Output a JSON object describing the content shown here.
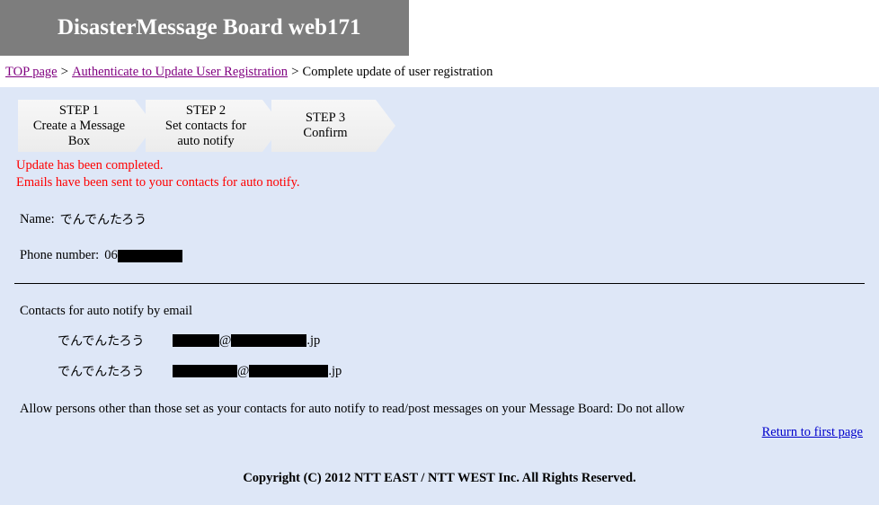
{
  "header": {
    "title": "DisasterMessage Board web171",
    "bg_color": "#7d7d7d",
    "title_color": "#ffffff"
  },
  "breadcrumb": {
    "items": [
      {
        "label": "TOP page",
        "link": true
      },
      {
        "label": "Authenticate to Update User Registration",
        "link": true
      },
      {
        "label": "Complete update of user registration",
        "link": false
      }
    ],
    "separator": ">",
    "link_color": "#800080"
  },
  "steps": [
    {
      "number": "STEP 1",
      "label": "Create a Message\nBox",
      "line1": "STEP 1",
      "line2": "Create a Message",
      "line3": "Box"
    },
    {
      "number": "STEP 2",
      "label": "Set contacts for\nauto notify",
      "line1": "STEP 2",
      "line2": "Set contacts for",
      "line3": "auto notify"
    },
    {
      "number": "STEP 3",
      "label": "Confirm",
      "line1": "STEP 3",
      "line2": "Confirm",
      "line3": ""
    }
  ],
  "alerts": {
    "color": "#ff0000",
    "line1": "Update has been completed.",
    "line2": "Emails have been sent to your contacts for auto notify."
  },
  "user": {
    "name_label": "Name:",
    "name_value": "でんでんたろう",
    "phone_label": "Phone number:",
    "phone_prefix": "06",
    "phone_redacted": true
  },
  "contacts": {
    "title": "Contacts for auto notify by email",
    "rows": [
      {
        "name": "でんでんたろう",
        "at": "@",
        "tld": ".jp",
        "redacted": true
      },
      {
        "name": "でんでんたろう",
        "at": "@",
        "tld": ".jp",
        "redacted": true
      }
    ]
  },
  "permission": {
    "text": "Allow persons other than those set as your contacts for auto notify to read/post messages on your Message Board: Do not allow"
  },
  "return_link": {
    "label": "Return to first page",
    "color": "#0000cc"
  },
  "footer": {
    "copyright": "Copyright (C) 2012 NTT EAST / NTT WEST Inc. All Rights Reserved."
  },
  "theme": {
    "content_bg": "#dee7f7",
    "page_bg": "#ffffff",
    "divider_color": "#000000"
  }
}
